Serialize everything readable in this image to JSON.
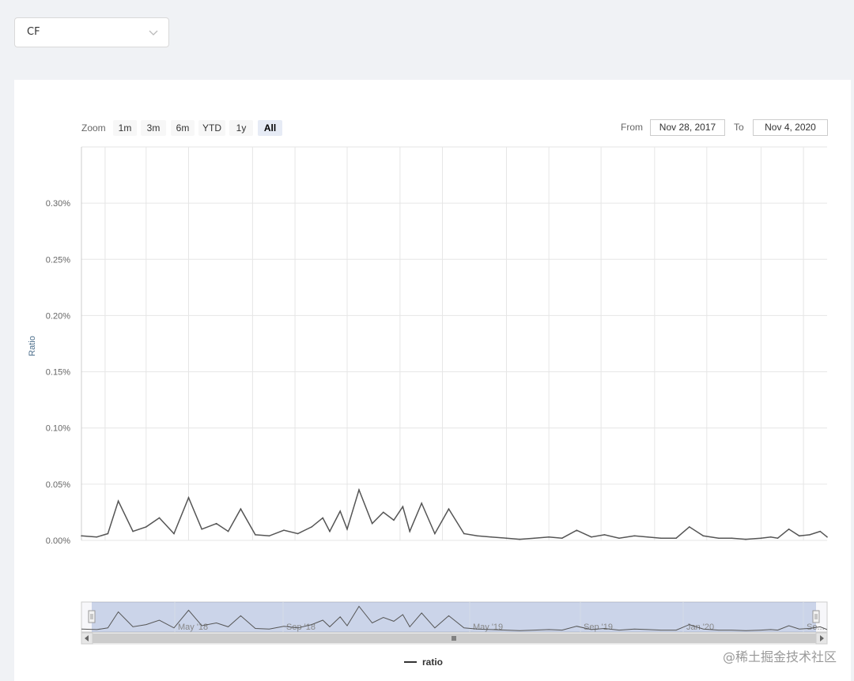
{
  "dropdown": {
    "value": "CF"
  },
  "range_selector": {
    "zoom_label": "Zoom",
    "buttons": [
      {
        "label": "1m",
        "selected": false
      },
      {
        "label": "3m",
        "selected": false
      },
      {
        "label": "6m",
        "selected": false
      },
      {
        "label": "YTD",
        "selected": false
      },
      {
        "label": "1y",
        "selected": false
      },
      {
        "label": "All",
        "selected": true
      }
    ],
    "from_label": "From",
    "from_value": "Nov 28, 2017",
    "to_label": "To",
    "to_value": "Nov 4, 2020"
  },
  "watermark": "@稀土掘金技术社区",
  "colors": {
    "line": "#555555",
    "navigator_mask": "rgba(102,133,194,0.3)",
    "selected_button": "#e6ebf5"
  },
  "chart_data": {
    "type": "line",
    "x_range": [
      "2017-11-28",
      "2020-11-04"
    ],
    "ylabel": "Ratio",
    "ylim": [
      0,
      0.35
    ],
    "y_ticks": [
      "0.00%",
      "0.05%",
      "0.10%",
      "0.15%",
      "0.20%",
      "0.25%",
      "0.30%"
    ],
    "grid": true,
    "legend": "bottom-center",
    "navigator_ticks": [
      "May '18",
      "Sep '18",
      "May '19",
      "Sep '19",
      "Jan '20",
      "Se..."
    ],
    "series": [
      {
        "name": "ratio",
        "x": [
          "2017-11-28",
          "2017-12-20",
          "2018-01-05",
          "2018-01-20",
          "2018-02-10",
          "2018-03-01",
          "2018-03-20",
          "2018-04-10",
          "2018-05-01",
          "2018-05-20",
          "2018-06-10",
          "2018-06-27",
          "2018-07-15",
          "2018-08-05",
          "2018-08-25",
          "2018-09-15",
          "2018-10-05",
          "2018-10-25",
          "2018-11-10",
          "2018-11-20",
          "2018-12-05",
          "2018-12-15",
          "2019-01-01",
          "2019-01-20",
          "2019-02-05",
          "2019-02-20",
          "2019-03-05",
          "2019-03-15",
          "2019-04-01",
          "2019-04-20",
          "2019-05-10",
          "2019-06-01",
          "2019-06-20",
          "2019-07-10",
          "2019-08-01",
          "2019-08-20",
          "2019-09-10",
          "2019-10-01",
          "2019-10-20",
          "2019-11-10",
          "2019-12-01",
          "2019-12-20",
          "2020-01-10",
          "2020-02-01",
          "2020-02-20",
          "2020-03-10",
          "2020-04-01",
          "2020-04-20",
          "2020-05-10",
          "2020-06-01",
          "2020-06-20",
          "2020-07-10",
          "2020-08-01",
          "2020-08-15",
          "2020-08-25",
          "2020-09-10",
          "2020-09-25",
          "2020-10-10",
          "2020-10-25",
          "2020-11-04"
        ],
        "values": [
          0.004,
          0.003,
          0.006,
          0.035,
          0.008,
          0.012,
          0.02,
          0.006,
          0.038,
          0.01,
          0.015,
          0.008,
          0.028,
          0.005,
          0.004,
          0.009,
          0.006,
          0.012,
          0.02,
          0.008,
          0.026,
          0.01,
          0.045,
          0.015,
          0.025,
          0.018,
          0.03,
          0.008,
          0.033,
          0.006,
          0.028,
          0.006,
          0.004,
          0.003,
          0.002,
          0.001,
          0.002,
          0.003,
          0.002,
          0.009,
          0.003,
          0.005,
          0.002,
          0.004,
          0.003,
          0.002,
          0.002,
          0.012,
          0.004,
          0.002,
          0.002,
          0.001,
          0.002,
          0.003,
          0.002,
          0.01,
          0.004,
          0.005,
          0.008,
          0.003
        ]
      }
    ]
  }
}
